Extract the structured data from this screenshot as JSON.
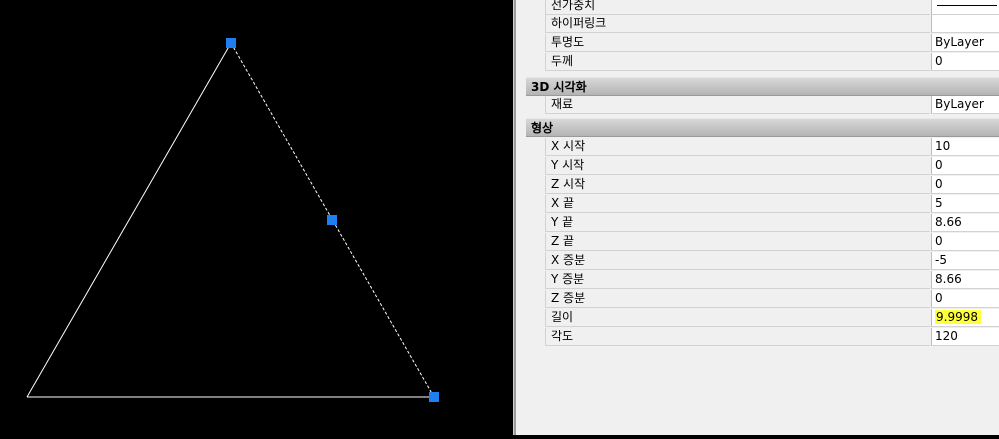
{
  "properties": {
    "general_rows": [
      {
        "name": "선가중치",
        "value": ""
      },
      {
        "name": "하이퍼링크",
        "value": ""
      },
      {
        "name": "투명도",
        "value": "ByLayer"
      },
      {
        "name": "두께",
        "value": "0"
      }
    ],
    "categories": {
      "visualization": "3D 시각화",
      "geometry": "형상"
    },
    "visualization_rows": [
      {
        "name": "재료",
        "value": "ByLayer"
      }
    ],
    "geometry_rows": [
      {
        "name": "X 시작",
        "value": "10"
      },
      {
        "name": "Y 시작",
        "value": "0"
      },
      {
        "name": "Z 시작",
        "value": "0"
      },
      {
        "name": "X 끝",
        "value": "5"
      },
      {
        "name": "Y 끝",
        "value": "8.66"
      },
      {
        "name": "Z 끝",
        "value": "0"
      },
      {
        "name": "X 증분",
        "value": "-5"
      },
      {
        "name": "Y 증분",
        "value": "8.66"
      },
      {
        "name": "Z 증분",
        "value": "0"
      },
      {
        "name": "길이",
        "value": "9.9998"
      },
      {
        "name": "각도",
        "value": "120"
      }
    ]
  },
  "colors": {
    "grip": "#1e7ff0",
    "highlight": "#ffff3a",
    "line": "#ffffff"
  }
}
